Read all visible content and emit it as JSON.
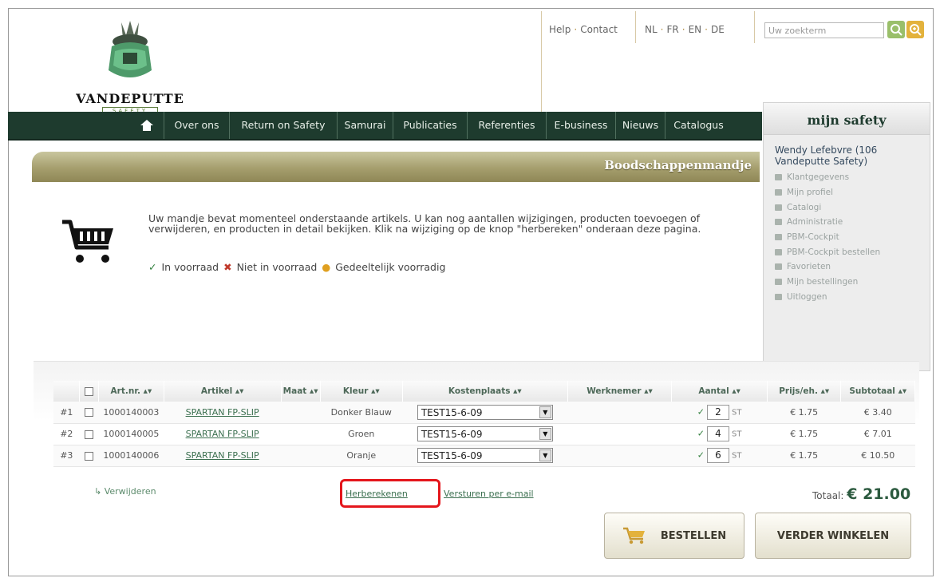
{
  "brand": {
    "name": "VANDEPUTTE",
    "tagline": "SAFETY"
  },
  "utility": {
    "help": "Help",
    "contact": "Contact",
    "langs": [
      "NL",
      "FR",
      "EN",
      "DE"
    ],
    "separator": "·"
  },
  "search": {
    "placeholder": "Uw zoekterm"
  },
  "nav": [
    "Over ons",
    "Return on Safety",
    "Samurai",
    "Publicaties",
    "Referenties",
    "E-business",
    "Nieuws",
    "Catalogus"
  ],
  "sidebar": {
    "title": "mijn safety",
    "user": "Wendy Lefebvre (106 Vandeputte Safety)",
    "items": [
      "Klantgegevens",
      "Mijn profiel",
      "Catalogi",
      "Administratie",
      "PBM-Cockpit",
      "PBM-Cockpit bestellen",
      "Favorieten",
      "Mijn bestellingen",
      "Uitloggen"
    ]
  },
  "banner": {
    "title": "Boodschappenmandje"
  },
  "intro": "Uw mandje bevat momenteel onderstaande artikels. U kan nog aantallen wijzigingen, producten toevoegen of verwijderen, en producten in detail bekijken. Klik na wijziging op de knop \"herbereken\" onderaan deze pagina.",
  "legend": {
    "in_stock": "In voorraad",
    "not_in_stock": "Niet in voorraad",
    "partial": "Gedeeltelijk voorradig"
  },
  "table": {
    "headers": [
      "Art.nr.",
      "Artikel",
      "Maat",
      "Kleur",
      "Kostenplaats",
      "Werknemer",
      "Aantal",
      "Prijs/eh.",
      "Subtotaal"
    ],
    "sort_icon": "▴▾",
    "rows": [
      {
        "idx": "#1",
        "artnr": "1000140003",
        "artikel": "SPARTAN FP-SLIP",
        "maat": "",
        "kleur": "Donker Blauw",
        "kostenplaats": "TEST15-6-09",
        "werknemer": "",
        "aantal": "2",
        "unit": "ST",
        "prijs": "€ 1.75",
        "subtotaal": "€ 3.40"
      },
      {
        "idx": "#2",
        "artnr": "1000140005",
        "artikel": "SPARTAN FP-SLIP",
        "maat": "",
        "kleur": "Groen",
        "kostenplaats": "TEST15-6-09",
        "werknemer": "",
        "aantal": "4",
        "unit": "ST",
        "prijs": "€ 1.75",
        "subtotaal": "€ 7.01"
      },
      {
        "idx": "#3",
        "artnr": "1000140006",
        "artikel": "SPARTAN FP-SLIP",
        "maat": "",
        "kleur": "Oranje",
        "kostenplaats": "TEST15-6-09",
        "werknemer": "",
        "aantal": "6",
        "unit": "ST",
        "prijs": "€ 1.75",
        "subtotaal": "€ 10.50"
      }
    ]
  },
  "actions": {
    "remove": "Verwijderen",
    "recalc": "Herberekenen",
    "email": "Versturen per e-mail",
    "total_label": "Totaal:",
    "total_value": "€ 21.00",
    "order": "BESTELLEN",
    "continue": "VERDER WINKELEN"
  },
  "colors": {
    "nav_bg": "#1e3b2e",
    "accent_gold": "#a8802a",
    "highlight": "#e4161c"
  }
}
